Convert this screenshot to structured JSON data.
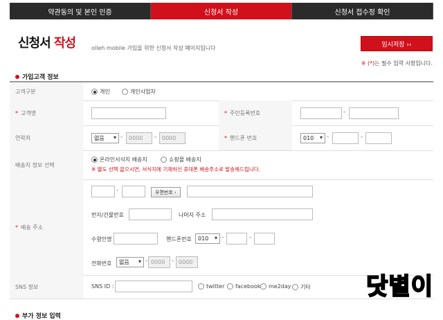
{
  "steps": [
    {
      "label": "약관동의 및 본인 인증",
      "active": false
    },
    {
      "label": "신청서 작성",
      "active": true
    },
    {
      "label": "신청서 접수정 확인",
      "active": false
    }
  ],
  "page": {
    "title_part1": "신청서",
    "title_part2": "작성",
    "subtitle": "olleh mobile 가입을 위한 신청서 작성 페이지입니다",
    "save_button": "임시저장 ››",
    "required_note_star": "※ (*)",
    "required_note_text": "는 필수 입력 사항입니다."
  },
  "section": {
    "title": "가입고객 정보",
    "next_title": "부가 정보 입력"
  },
  "form": {
    "customer_type_label": "고객구분",
    "customer_type_options": [
      "개인",
      "개인사업자"
    ],
    "customer_name_label": "고객명",
    "rrn_label": "주민등록번호",
    "contact_label": "연락처",
    "contact_select": "없음",
    "contact_ph1": "0000",
    "contact_ph2": "0000",
    "mobile_label": "핸드폰 번호",
    "mobile_select": "010",
    "delivery_info_label": "배송지 정보 선택",
    "delivery_options": [
      "온라인서식지 배송지",
      "쇼핑몰 배송지"
    ],
    "delivery_note": "※ 별도 선택 없으시면, 서식지에 기재하신 휴대폰 배송주소로 발송해드립니다.",
    "address_label": "배송 주소",
    "zip_button": "우편번호 ›",
    "lot_label": "번지/건물번호",
    "rest_label": "나머지 주소",
    "receiver_label": "수령인명",
    "receiver_mobile_label": "핸드폰번호",
    "receiver_mobile_select": "010",
    "phone_label": "전화번호",
    "phone_select": "없음",
    "phone_ph1": "0000",
    "phone_ph2": "0000",
    "sns_label": "SNS 정보",
    "sns_id_label": "SNS ID :",
    "sns_options": [
      "twitter",
      "facebook",
      "me2day",
      "기타"
    ]
  },
  "watermark": "닷별이"
}
